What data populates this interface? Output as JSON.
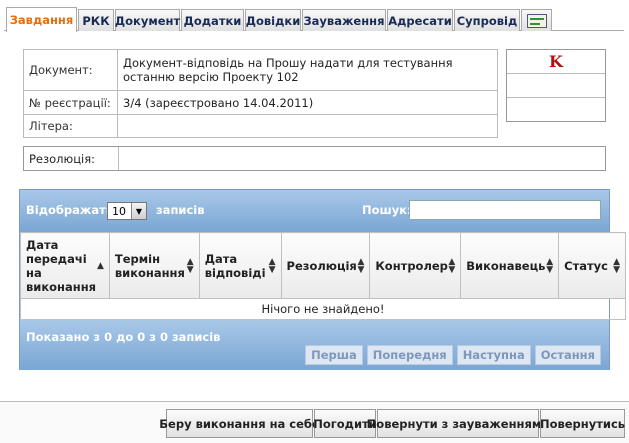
{
  "tabs": [
    {
      "label": "Завдання",
      "active": true
    },
    {
      "label": "РКК"
    },
    {
      "label": "Документ"
    },
    {
      "label": "Додатки"
    },
    {
      "label": "Довідки"
    },
    {
      "label": "Зауваження"
    },
    {
      "label": "Адресати"
    },
    {
      "label": "Супровід"
    },
    {
      "icon": "spreadsheet-icon"
    }
  ],
  "info": {
    "document_label": "Документ:",
    "document_value": "Документ-відповідь на Прошу надати для тестування останню версію Проекту 102",
    "reg_label": "№ реєстрації:",
    "reg_value": "3/4 (зареєстровано 14.04.2011)",
    "litera_label": "Літера:",
    "litera_value": ""
  },
  "k_box": {
    "letter": "K"
  },
  "resolution": {
    "label": "Резолюція:",
    "value": ""
  },
  "grid": {
    "show_label": "Відображати",
    "records_label": "записів",
    "page_length": "10",
    "search_label": "Пошук:",
    "search_value": "",
    "columns": [
      "Дата передачі на виконання",
      "Термін виконання",
      "Дата відповіді",
      "Резолюція",
      "Контролер",
      "Виконавець",
      "Статус"
    ],
    "empty_text": "Нічого не знайдено!",
    "info_text": "Показано з 0 до 0 з 0 записів",
    "pager": {
      "first": "Перша",
      "prev": "Попередня",
      "next": "Наступна",
      "last": "Остання"
    }
  },
  "actions": {
    "take": "Беру виконання на себе",
    "agree": "Погодити",
    "return_comments": "Повернути з зауваженнями",
    "return": "Повернутись"
  },
  "colors": {
    "accent": "#e07010",
    "header_blue": "#7aa6d4",
    "k_red": "#b01010"
  }
}
